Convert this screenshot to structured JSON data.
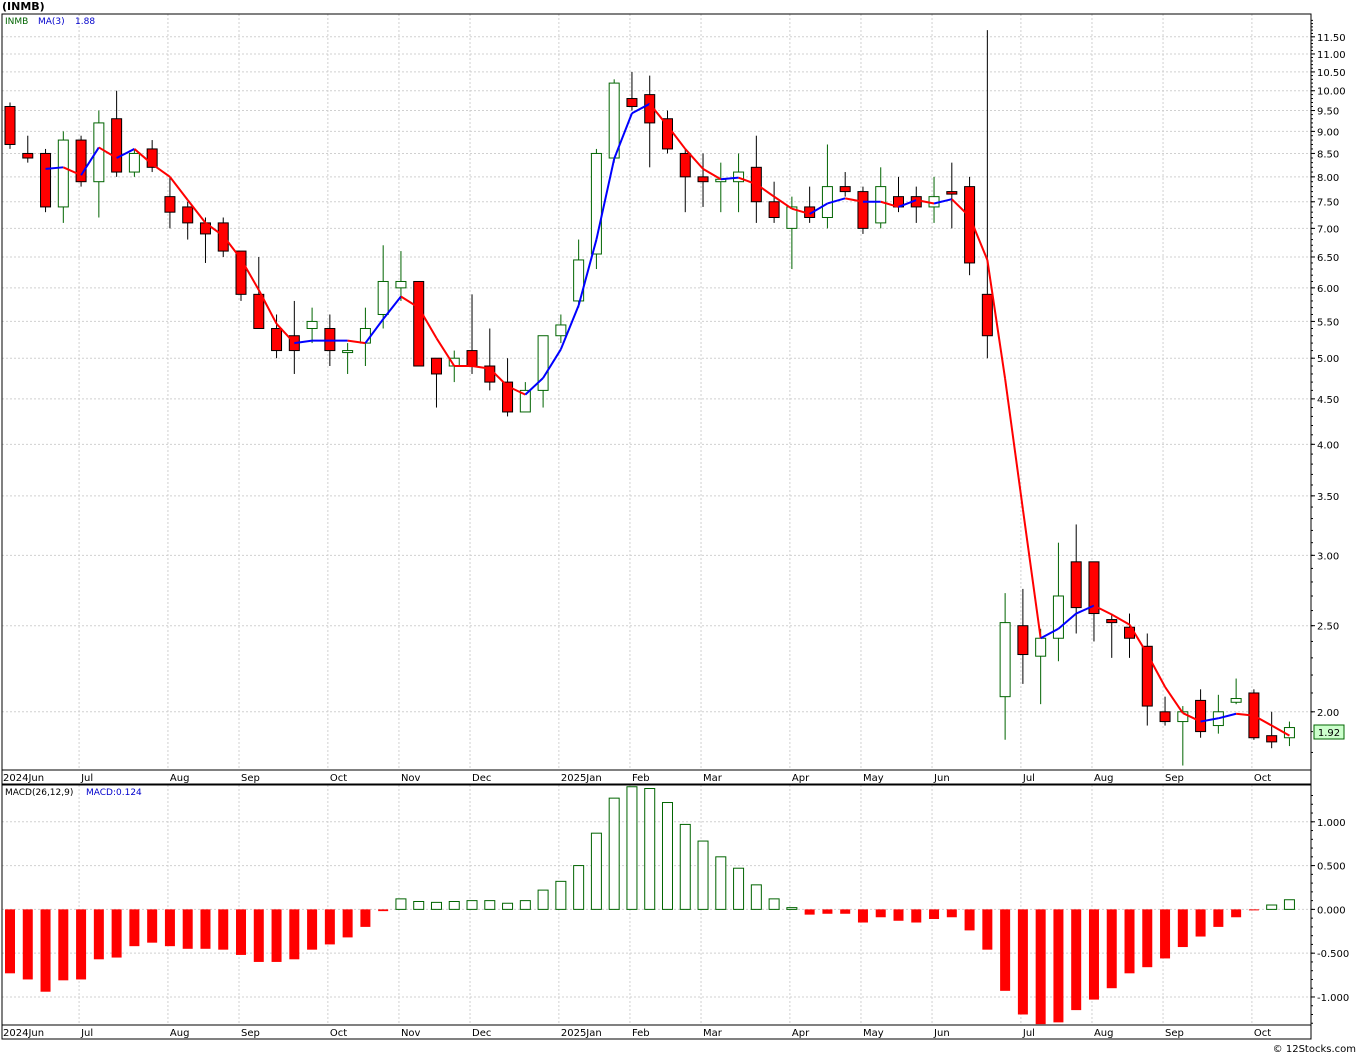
{
  "header": {
    "symbol": "(INMB)",
    "credit": "© 12Stocks.com"
  },
  "colors": {
    "up": "#006400",
    "down": "#ff0000",
    "ma_up": "#0000ff",
    "ma_down": "#ff0000",
    "grid": "#d0d0d0",
    "last_label_bg": "#ccffcc"
  },
  "chart_data": [
    {
      "type": "candlestick",
      "name": "price-panel",
      "legend": {
        "symbol": "INMB",
        "ma_label": "MA(3)",
        "ma_value": "1.88"
      },
      "y_scale": "log",
      "ylim": [
        1.72,
        12.2
      ],
      "y_ticks": [
        "2.00",
        "2.50",
        "3.00",
        "3.50",
        "4.00",
        "4.50",
        "5.00",
        "5.50",
        "6.00",
        "6.50",
        "7.00",
        "7.50",
        "8.00",
        "8.50",
        "9.00",
        "9.50",
        "10.00",
        "10.50",
        "11.00",
        "11.50"
      ],
      "last_price_label": "1.92",
      "x_labels": [
        {
          "label": "2024Jun",
          "week": 0
        },
        {
          "label": "Jul",
          "week": 4
        },
        {
          "label": "Aug",
          "week": 9
        },
        {
          "label": "Sep",
          "week": 13
        },
        {
          "label": "Oct",
          "week": 18
        },
        {
          "label": "Nov",
          "week": 22
        },
        {
          "label": "Dec",
          "week": 26
        },
        {
          "label": "2025Jan",
          "week": 31
        },
        {
          "label": "Feb",
          "week": 35
        },
        {
          "label": "Mar",
          "week": 39
        },
        {
          "label": "Apr",
          "week": 44
        },
        {
          "label": "May",
          "week": 48
        },
        {
          "label": "Jun",
          "week": 52
        },
        {
          "label": "Jul",
          "week": 57
        },
        {
          "label": "Aug",
          "week": 61
        },
        {
          "label": "Sep",
          "week": 65
        },
        {
          "label": "Oct",
          "week": 70
        }
      ],
      "candles": [
        [
          9.6,
          9.7,
          8.6,
          8.7
        ],
        [
          8.5,
          8.9,
          8.3,
          8.4
        ],
        [
          8.5,
          8.6,
          7.3,
          7.4
        ],
        [
          7.4,
          9.0,
          7.1,
          8.8
        ],
        [
          8.8,
          8.9,
          7.8,
          7.9
        ],
        [
          7.9,
          9.5,
          7.2,
          9.2
        ],
        [
          9.3,
          10.0,
          8.0,
          8.1
        ],
        [
          8.1,
          8.6,
          8.0,
          8.5
        ],
        [
          8.6,
          8.8,
          8.1,
          8.2
        ],
        [
          7.6,
          8.0,
          7.0,
          7.3
        ],
        [
          7.4,
          7.5,
          6.8,
          7.1
        ],
        [
          7.1,
          7.2,
          6.4,
          6.9
        ],
        [
          7.1,
          7.2,
          6.5,
          6.6
        ],
        [
          6.6,
          6.6,
          5.8,
          5.9
        ],
        [
          5.9,
          6.5,
          5.5,
          5.4
        ],
        [
          5.4,
          5.6,
          5.0,
          5.1
        ],
        [
          5.3,
          5.8,
          4.8,
          5.1
        ],
        [
          5.4,
          5.7,
          5.2,
          5.5
        ],
        [
          5.4,
          5.6,
          4.9,
          5.1
        ],
        [
          5.1,
          5.2,
          4.8,
          5.1
        ],
        [
          5.2,
          5.7,
          4.9,
          5.4
        ],
        [
          5.6,
          6.7,
          5.4,
          6.1
        ],
        [
          6.0,
          6.6,
          5.8,
          6.1
        ],
        [
          6.1,
          6.1,
          4.9,
          4.9
        ],
        [
          5.0,
          5.0,
          4.4,
          4.8
        ],
        [
          4.9,
          5.1,
          4.7,
          5.0
        ],
        [
          5.1,
          5.9,
          4.8,
          4.9
        ],
        [
          4.9,
          5.4,
          4.6,
          4.7
        ],
        [
          4.7,
          5.0,
          4.3,
          4.35
        ],
        [
          4.35,
          4.7,
          4.35,
          4.6
        ],
        [
          4.6,
          5.3,
          4.4,
          5.3
        ],
        [
          5.3,
          5.6,
          5.2,
          5.45
        ],
        [
          5.8,
          6.8,
          5.7,
          6.45
        ],
        [
          6.55,
          8.6,
          6.3,
          8.5
        ],
        [
          8.4,
          10.3,
          8.3,
          10.2
        ],
        [
          9.8,
          10.5,
          9.5,
          9.6
        ],
        [
          9.9,
          10.4,
          8.2,
          9.2
        ],
        [
          9.3,
          9.5,
          8.5,
          8.6
        ],
        [
          8.5,
          8.6,
          7.3,
          8.0
        ],
        [
          8.0,
          8.5,
          7.4,
          7.9
        ],
        [
          7.9,
          8.3,
          7.3,
          7.95
        ],
        [
          7.9,
          8.5,
          7.3,
          8.1
        ],
        [
          8.2,
          8.9,
          7.1,
          7.5
        ],
        [
          7.5,
          7.9,
          7.1,
          7.2
        ],
        [
          7.0,
          7.6,
          6.3,
          7.4
        ],
        [
          7.4,
          7.8,
          7.1,
          7.2
        ],
        [
          7.2,
          8.7,
          7.0,
          7.8
        ],
        [
          7.8,
          8.1,
          7.6,
          7.7
        ],
        [
          7.7,
          7.8,
          6.9,
          7.0
        ],
        [
          7.1,
          8.2,
          7.0,
          7.8
        ],
        [
          7.6,
          8.0,
          7.3,
          7.4
        ],
        [
          7.6,
          7.8,
          7.1,
          7.4
        ],
        [
          7.4,
          8.0,
          7.1,
          7.6
        ],
        [
          7.7,
          8.3,
          7.0,
          7.65
        ],
        [
          7.8,
          8.0,
          6.2,
          6.4
        ],
        [
          5.9,
          11.7,
          5.0,
          5.3
        ],
        [
          2.08,
          2.72,
          1.86,
          2.52
        ],
        [
          2.5,
          2.75,
          2.15,
          2.32
        ],
        [
          2.31,
          2.48,
          2.04,
          2.42
        ],
        [
          2.42,
          3.1,
          2.28,
          2.7
        ],
        [
          2.95,
          3.25,
          2.45,
          2.62
        ],
        [
          2.95,
          2.95,
          2.4,
          2.58
        ],
        [
          2.54,
          2.58,
          2.3,
          2.52
        ],
        [
          2.49,
          2.58,
          2.3,
          2.42
        ],
        [
          2.37,
          2.45,
          1.93,
          2.03
        ],
        [
          2.0,
          2.08,
          1.93,
          1.95
        ],
        [
          1.95,
          2.03,
          1.74,
          2.0
        ],
        [
          2.06,
          2.12,
          1.87,
          1.9
        ],
        [
          1.93,
          2.09,
          1.89,
          2.0
        ],
        [
          2.05,
          2.18,
          2.04,
          2.07
        ],
        [
          2.1,
          2.12,
          1.86,
          1.87
        ],
        [
          1.88,
          2.0,
          1.82,
          1.85
        ],
        [
          1.87,
          1.95,
          1.83,
          1.92
        ]
      ]
    },
    {
      "type": "bar",
      "name": "macd-panel",
      "legend": {
        "label": "MACD(26,12,9)",
        "value_label": "MACD:0.124"
      },
      "ylim": [
        -1.32,
        1.42
      ],
      "y_ticks": [
        "1.000",
        "0.500",
        "0.000",
        "-0.500",
        "-1.000"
      ],
      "x_labels": [
        {
          "label": "2024Jun",
          "week": 0
        },
        {
          "label": "Jul",
          "week": 4
        },
        {
          "label": "Aug",
          "week": 9
        },
        {
          "label": "Sep",
          "week": 13
        },
        {
          "label": "Oct",
          "week": 18
        },
        {
          "label": "Nov",
          "week": 22
        },
        {
          "label": "Dec",
          "week": 26
        },
        {
          "label": "2025Jan",
          "week": 31
        },
        {
          "label": "Feb",
          "week": 35
        },
        {
          "label": "Mar",
          "week": 39
        },
        {
          "label": "Apr",
          "week": 44
        },
        {
          "label": "May",
          "week": 48
        },
        {
          "label": "Jun",
          "week": 52
        },
        {
          "label": "Jul",
          "week": 57
        },
        {
          "label": "Aug",
          "week": 61
        },
        {
          "label": "Sep",
          "week": 65
        },
        {
          "label": "Oct",
          "week": 70
        }
      ],
      "values": [
        -0.73,
        -0.8,
        -0.94,
        -0.81,
        -0.8,
        -0.57,
        -0.55,
        -0.42,
        -0.38,
        -0.42,
        -0.45,
        -0.45,
        -0.46,
        -0.52,
        -0.6,
        -0.6,
        -0.57,
        -0.46,
        -0.4,
        -0.32,
        -0.2,
        -0.02,
        0.12,
        0.09,
        0.08,
        0.09,
        0.1,
        0.1,
        0.07,
        0.1,
        0.22,
        0.32,
        0.5,
        0.87,
        1.27,
        1.4,
        1.38,
        1.22,
        0.97,
        0.78,
        0.6,
        0.47,
        0.28,
        0.12,
        0.02,
        -0.06,
        -0.05,
        -0.05,
        -0.15,
        -0.09,
        -0.13,
        -0.15,
        -0.11,
        -0.09,
        -0.24,
        -0.46,
        -0.93,
        -1.2,
        -1.31,
        -1.29,
        -1.15,
        -1.03,
        -0.9,
        -0.73,
        -0.66,
        -0.56,
        -0.43,
        -0.31,
        -0.2,
        -0.09,
        -0.01,
        0.05,
        0.11
      ]
    }
  ]
}
